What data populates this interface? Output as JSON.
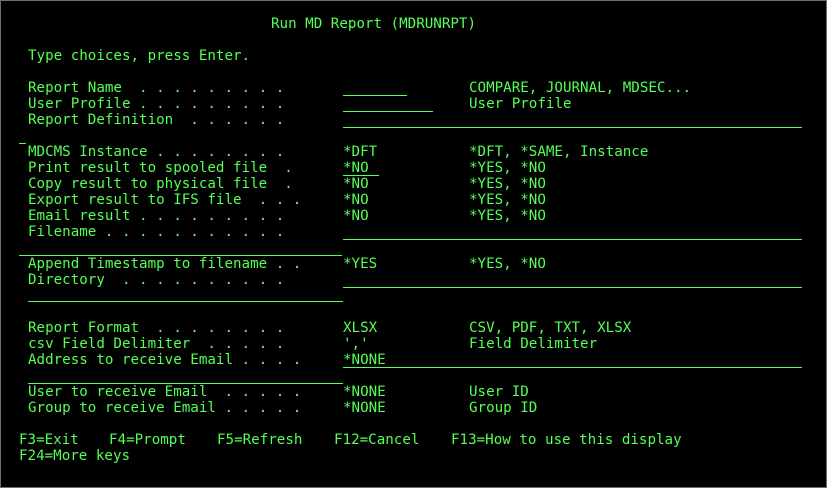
{
  "screen": {
    "title": "Run MD Report (MDRUNRPT)",
    "instruction": "Type choices, press Enter."
  },
  "rows": {
    "report_name": {
      "label": "Report Name  . . . . . . . . .",
      "value": "",
      "hint": "COMPARE, JOURNAL, MDSEC..."
    },
    "user_profile": {
      "label": "User Profile . . . . . . . . .",
      "value": "",
      "hint": "User Profile"
    },
    "report_definition": {
      "label": "Report Definition  . . . . . .",
      "value": ""
    },
    "mdcms_instance": {
      "label": "MDCMS Instance . . . . . . . .",
      "value": "*DFT",
      "hint": "*DFT, *SAME, Instance"
    },
    "print_spooled": {
      "label": "Print result to spooled file  .",
      "value": "*NO",
      "hint": "*YES, *NO"
    },
    "copy_physical": {
      "label": "Copy result to physical file  .",
      "value": "*NO",
      "hint": "*YES, *NO"
    },
    "export_ifs": {
      "label": "Export result to IFS file  . . .",
      "value": "*NO",
      "hint": "*YES, *NO"
    },
    "email_result": {
      "label": "Email result . . . . . . . . .",
      "value": "*NO",
      "hint": "*YES, *NO"
    },
    "filename": {
      "label": "Filename . . . . . . . . . . .",
      "value": ""
    },
    "append_timestamp": {
      "label": "Append Timestamp to filename . .",
      "value": "*YES",
      "hint": "*YES, *NO"
    },
    "directory": {
      "label": "Directory  . . . . . . . . . .",
      "value": ""
    },
    "report_format": {
      "label": "Report Format  . . . . . . . .",
      "value": "XLSX",
      "hint": "CSV, PDF, TXT, XLSX"
    },
    "csv_delimiter": {
      "label": "csv Field Delimiter  . . . . .",
      "value": "','",
      "hint": "Field Delimiter"
    },
    "email_address": {
      "label": "Address to receive Email . . . .",
      "value": "*NONE"
    },
    "email_user": {
      "label": "User to receive Email  . . . . .",
      "value": "*NONE",
      "hint": "User ID"
    },
    "email_group": {
      "label": "Group to receive Email . . . . .",
      "value": "*NONE",
      "hint": "Group ID"
    }
  },
  "function_keys": {
    "f3": "F3=Exit",
    "f4": "F4=Prompt",
    "f5": "F5=Refresh",
    "f12": "F12=Cancel",
    "f13": "F13=How to use this display",
    "f24": "F24=More keys"
  },
  "colors": {
    "foreground": "#55ff55",
    "background": "#000000"
  }
}
